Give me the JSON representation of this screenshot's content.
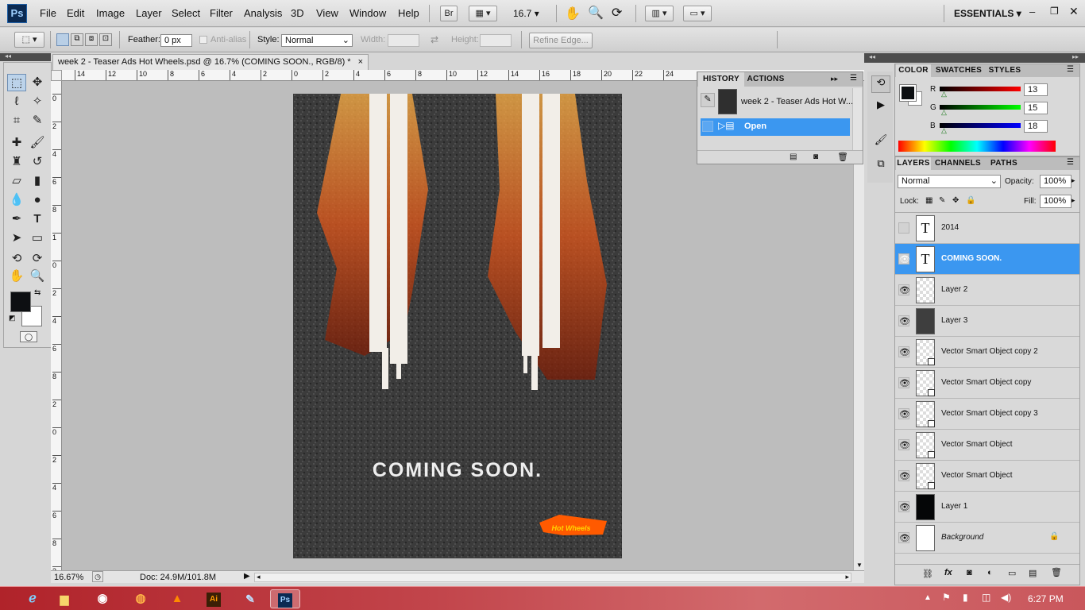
{
  "app": {
    "logo": "Ps",
    "workspace": "ESSENTIALS"
  },
  "menu": [
    "File",
    "Edit",
    "Image",
    "Layer",
    "Select",
    "Filter",
    "Analysis",
    "3D",
    "View",
    "Window",
    "Help"
  ],
  "toolbar_top": {
    "bridge": "Br",
    "zoom": "16.7"
  },
  "options": {
    "feather_label": "Feather:",
    "feather_value": "0 px",
    "antialias_label": "Anti-alias",
    "style_label": "Style:",
    "style_value": "Normal",
    "width_label": "Width:",
    "height_label": "Height:",
    "refine_label": "Refine Edge..."
  },
  "document": {
    "tab_title": "week 2 - Teaser Ads Hot Wheels.psd @ 16.7% (COMING SOON., RGB/8) *",
    "close_glyph": "×",
    "poster_text": "COMING SOON.",
    "logo_text": "Hot Wheels",
    "ruler_h": [
      "14",
      "12",
      "10",
      "8",
      "6",
      "4",
      "2",
      "0",
      "2",
      "4",
      "6",
      "8",
      "10",
      "12",
      "14",
      "16",
      "18",
      "20",
      "22",
      "24"
    ],
    "ruler_v": [
      "0",
      "2",
      "4",
      "6",
      "8",
      "1",
      "0",
      "2",
      "4",
      "6",
      "8",
      "2",
      "0",
      "2",
      "4",
      "6",
      "8",
      "3"
    ],
    "status_zoom": "16.67%",
    "status_doc": "Doc: 24.9M/101.8M"
  },
  "history": {
    "tabs": [
      "HISTORY",
      "ACTIONS"
    ],
    "snapshot": "week 2 - Teaser Ads Hot W...",
    "states": [
      "Open"
    ]
  },
  "color": {
    "tabs": [
      "COLOR",
      "SWATCHES",
      "STYLES"
    ],
    "channels": [
      {
        "label": "R",
        "value": "13"
      },
      {
        "label": "G",
        "value": "15"
      },
      {
        "label": "B",
        "value": "18"
      }
    ]
  },
  "layers": {
    "tabs": [
      "LAYERS",
      "CHANNELS",
      "PATHS"
    ],
    "blend_mode": "Normal",
    "opacity_label": "Opacity:",
    "opacity_value": "100%",
    "lock_label": "Lock:",
    "fill_label": "Fill:",
    "fill_value": "100%",
    "items": [
      {
        "name": "2014",
        "type": "text",
        "visible": false,
        "selected": false
      },
      {
        "name": "COMING SOON.",
        "type": "text",
        "visible": true,
        "selected": true
      },
      {
        "name": "Layer 2",
        "type": "raster",
        "visible": true,
        "selected": false
      },
      {
        "name": "Layer 3",
        "type": "raster",
        "visible": true,
        "selected": false
      },
      {
        "name": "Vector Smart Object copy 2",
        "type": "smart",
        "visible": true,
        "selected": false
      },
      {
        "name": "Vector Smart Object copy",
        "type": "smart",
        "visible": true,
        "selected": false
      },
      {
        "name": "Vector Smart Object copy 3",
        "type": "smart",
        "visible": true,
        "selected": false
      },
      {
        "name": "Vector Smart Object",
        "type": "smart",
        "visible": true,
        "selected": false
      },
      {
        "name": "Vector Smart Object",
        "type": "smart",
        "visible": true,
        "selected": false
      },
      {
        "name": "Layer 1",
        "type": "raster",
        "visible": true,
        "selected": false
      },
      {
        "name": "Background",
        "type": "background",
        "visible": true,
        "selected": false
      }
    ],
    "footer_fx": "fx"
  },
  "taskbar": {
    "apps": [
      "IE",
      "Explorer",
      "Chrome",
      "Firefox",
      "VLC",
      "Ai",
      "Paint",
      "Ps"
    ],
    "clock": "6:27 PM"
  }
}
